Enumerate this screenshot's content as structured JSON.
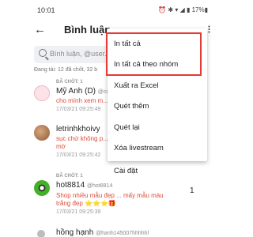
{
  "status": {
    "time": "10:01",
    "icons": "⏰ ✱ ▾ ◢ ▮ 17%▮"
  },
  "appbar": {
    "title": "Bình luận"
  },
  "search": {
    "placeholder": "Bình luận, @user..."
  },
  "summary": "Đang tải: 12 đã chốt, 32 b",
  "comments": [
    {
      "tag": "ĐÃ CHỐT: 1",
      "name": "Mỹ Anh (D)",
      "handle": "@conf...",
      "text": "cho mình xem m...",
      "time": "17/03/21 09:25:49"
    },
    {
      "tag": "",
      "name": "letrinhkhoivy",
      "handle": "",
      "text": "sục chứ không p...",
      "text2": "mờ",
      "time": "17/03/21 09:25:42"
    },
    {
      "tag": "ĐÃ CHỐT: 1",
      "name": "hot8814",
      "handle": "@hot8814",
      "text": "Shop nhiều mẫu đẹp ... mấy mẫu màu",
      "text2": "trắng đẹp ⭐⭐⭐🎁",
      "time": "17/03/21 09:25:39"
    },
    {
      "tag": "",
      "name": "hồng hạnh",
      "handle": "@hanh145007hhhhhl",
      "text": "",
      "time": ""
    }
  ],
  "badge": "1",
  "menu": {
    "items": [
      "In tất cả",
      "In tất cả theo nhóm",
      "Xuất ra Excel",
      "Quét thêm",
      "Quét lại",
      "Xóa livestream",
      "Cài đặt"
    ]
  }
}
